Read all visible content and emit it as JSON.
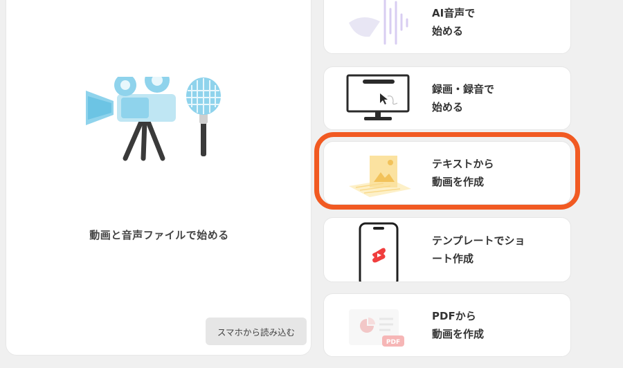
{
  "left_panel": {
    "caption": "動画と音声ファイルで始める",
    "phone_import_label": "スマホから読み込む"
  },
  "cards": {
    "ai_voice": {
      "line1": "AI音声で",
      "line2": "始める"
    },
    "record": {
      "line1": "録画・録音で",
      "line2": "始める"
    },
    "text_to_video": {
      "line1": "テキストから",
      "line2": "動画を作成"
    },
    "template_short": {
      "line1": "テンプレートでショ",
      "line2": "ート作成"
    },
    "pdf_to_video": {
      "line1": "PDFから",
      "line2": "動画を作成",
      "badge": "PDF"
    }
  },
  "colors": {
    "accent": "#f15a22",
    "camera_blue": "#8fd3ec",
    "waveform_purple": "#b9a6e8",
    "text_thumb_yellow": "#fbe2a0",
    "short_red": "#f03e3e"
  },
  "icons": [
    "video-camera-icon",
    "microphone-icon",
    "waveform-icon",
    "monitor-cursor-icon",
    "image-document-icon",
    "smartphone-short-icon",
    "pdf-document-icon"
  ]
}
